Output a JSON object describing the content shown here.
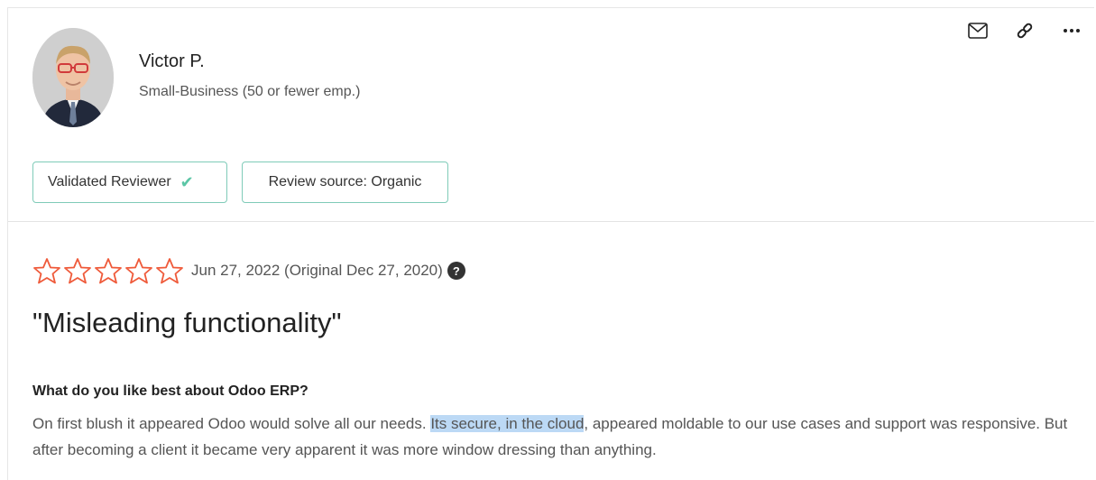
{
  "reviewer": {
    "name": "Victor P.",
    "segment": "Small-Business (50 or fewer emp.)",
    "badges": {
      "validated": "Validated Reviewer",
      "source": "Review source: Organic"
    }
  },
  "actions": {
    "email_icon": "envelope-icon",
    "link_icon": "link-icon",
    "more_icon": "more-dots-icon"
  },
  "review": {
    "rating": 0,
    "max_rating": 5,
    "date": "Jun 27, 2022",
    "original_date": "(Original Dec 27, 2020)",
    "help_glyph": "?",
    "title": "\"Misleading functionality\"",
    "question": "What do you like best about Odoo ERP?",
    "answer_before": "On first blush it appeared Odoo would solve all our needs. ",
    "answer_highlight": "Its secure, in the cloud",
    "answer_after": ", appeared moldable to our use cases and support was responsive. But after becoming a client it became very apparent it was more window dressing than anything."
  },
  "colors": {
    "star_outline": "#ef5a3a",
    "badge_border": "#7fcbb8",
    "check": "#5cc6a6",
    "highlight": "#bcd9f5"
  }
}
